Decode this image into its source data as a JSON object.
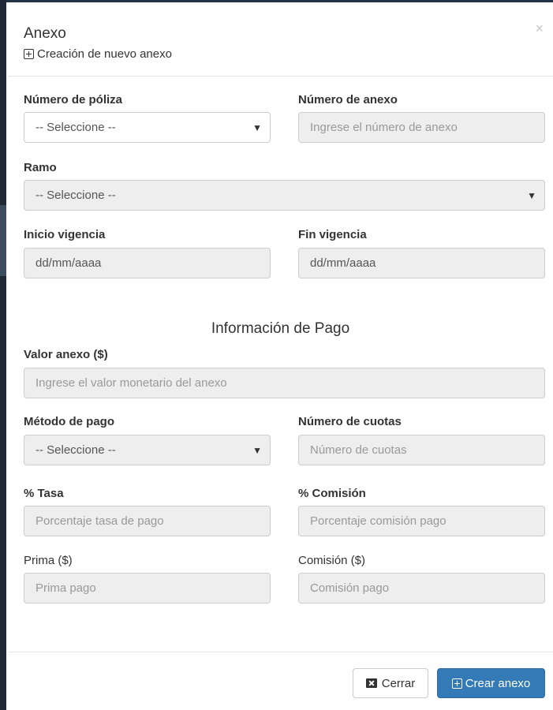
{
  "modal": {
    "title": "Anexo",
    "subtitle": "Creación de nuevo anexo",
    "close_symbol": "×"
  },
  "form": {
    "numero_poliza": {
      "label": "Número de póliza",
      "value": "-- Seleccione --"
    },
    "numero_anexo": {
      "label": "Número de anexo",
      "placeholder": "Ingrese el número de anexo"
    },
    "ramo": {
      "label": "Ramo",
      "value": "-- Seleccione --"
    },
    "inicio_vigencia": {
      "label": "Inicio vigencia",
      "placeholder": "dd/mm/aaaa"
    },
    "fin_vigencia": {
      "label": "Fin vigencia",
      "placeholder": "dd/mm/aaaa"
    }
  },
  "payment": {
    "section_title": "Información de Pago",
    "valor_anexo": {
      "label": "Valor anexo ($)",
      "placeholder": "Ingrese el valor monetario del anexo"
    },
    "metodo_pago": {
      "label": "Método de pago",
      "value": "-- Seleccione --"
    },
    "numero_cuotas": {
      "label": "Número de cuotas",
      "placeholder": "Número de cuotas"
    },
    "tasa": {
      "label": "% Tasa",
      "placeholder": "Porcentaje tasa de pago"
    },
    "comision_pct": {
      "label": "% Comisión",
      "placeholder": "Porcentaje comisión pago"
    },
    "prima": {
      "label": "Prima ($)",
      "placeholder": "Prima pago"
    },
    "comision": {
      "label": "Comisión ($)",
      "placeholder": "Comisión pago"
    }
  },
  "footer": {
    "close_label": "Cerrar",
    "create_label": "Crear anexo"
  },
  "icons": {
    "dropdown_arrow": "▼",
    "close_button_icon": "close-box-icon",
    "create_button_icon": "plus-box-icon"
  },
  "colors": {
    "primary": "#337ab7",
    "disabled_input": "#eeeeee",
    "border": "#cccccc"
  }
}
